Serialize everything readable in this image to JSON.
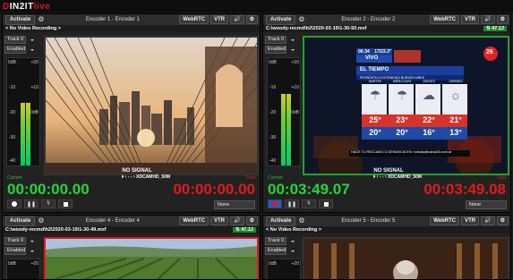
{
  "app": {
    "logo_prefix": "D",
    "logo_mid": "IN2IT",
    "logo_suffix": "live"
  },
  "common": {
    "activate": "Activate",
    "webrtc": "WebRTC",
    "vtr": "VTR",
    "track": "Track 0",
    "enabled": "Enabled",
    "no_signal": "NO SIGNAL",
    "current": "Current",
    "total": "Total",
    "none": "None",
    "db_labels": [
      "0dB",
      "-10",
      "-20",
      "-30",
      "-40",
      "+20",
      "+10",
      "0dB"
    ]
  },
  "encoders": [
    {
      "title": "Encoder 1 - Encoder 1",
      "recording": "< No Video Recording >",
      "current": "00:00:00.00",
      "total": "00:00:00.00",
      "format": "XDCAMHD_50M",
      "rate": ""
    },
    {
      "title": "Encoder 2 - Encoder 2",
      "recording": "C:\\woody-recmd\\h2\\2020-03-19\\1-30-50.mxf",
      "current": "00:03:49.07",
      "total": "00:03:49.08",
      "format": "XDCAMHD_50M",
      "rate": "47.12"
    },
    {
      "title": "Encoder 4 - Encoder 4",
      "recording": "C:\\woody-recmd\\h2\\2020-03-19\\1-30-49.mxf",
      "rate": "47.12"
    },
    {
      "title": "Encoder 5 - Encoder 5",
      "recording": "< No Video Recording >"
    }
  ],
  "weather": {
    "time": "06:34",
    "temp_now": "17/23.3°",
    "vivo": "VIVO",
    "channel": "26",
    "header": "EL TIEMPO",
    "sub": "PRONÓSTICO EXTENDIDO BUENOS AIRES",
    "days": [
      "MARTES",
      "MIÉRCOLES",
      "JUEVES",
      "VIERNES"
    ],
    "max": [
      "25°",
      "23°",
      "22°",
      "21°"
    ],
    "min": [
      "20°",
      "20°",
      "16°",
      "13°"
    ],
    "ticker": "HACE TU RECLAMO O DENUNCIA EN: noticias@canal26.com.ar"
  },
  "colors": {
    "red": "#e0161b",
    "green": "#1fa22e",
    "green_tc": "#27d43a",
    "red_tc": "#e11a1a"
  }
}
